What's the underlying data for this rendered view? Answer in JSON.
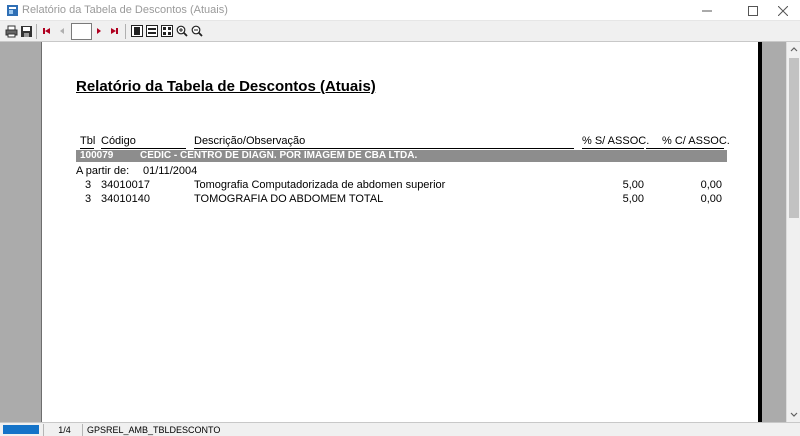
{
  "window": {
    "title": "Relatório da Tabela de Descontos (Atuais)"
  },
  "toolbar": {
    "page_value": ""
  },
  "report": {
    "title": "Relatório da Tabela de Descontos (Atuais)",
    "columns": {
      "tbl": "Tbl",
      "codigo": "Código",
      "descricao": "Descrição/Observação",
      "pct_sem": "% S/ ASSOC.",
      "pct_com": "% C/ ASSOC."
    },
    "group": {
      "code": "100079",
      "name": "CEDIC - CENTRO DE DIAGN. POR IMAGEM DE CBA LTDA."
    },
    "a_partir_label": "A partir de:",
    "a_partir_date": "01/11/2004",
    "rows": [
      {
        "tbl": "3",
        "codigo": "34010017",
        "descricao": "Tomografia Computadorizada de abdomen superior",
        "pct_sem": "5,00",
        "pct_com": "0,00"
      },
      {
        "tbl": "3",
        "codigo": "34010140",
        "descricao": "TOMOGRAFIA DO ABDOMEM TOTAL",
        "pct_sem": "5,00",
        "pct_com": "0,00"
      }
    ]
  },
  "status": {
    "page": "1/4",
    "report_name": "GPSREL_AMB_TBLDESCONTO"
  },
  "colors": {
    "group_bar": "#8d8d8d",
    "progress": "#1473c8"
  }
}
